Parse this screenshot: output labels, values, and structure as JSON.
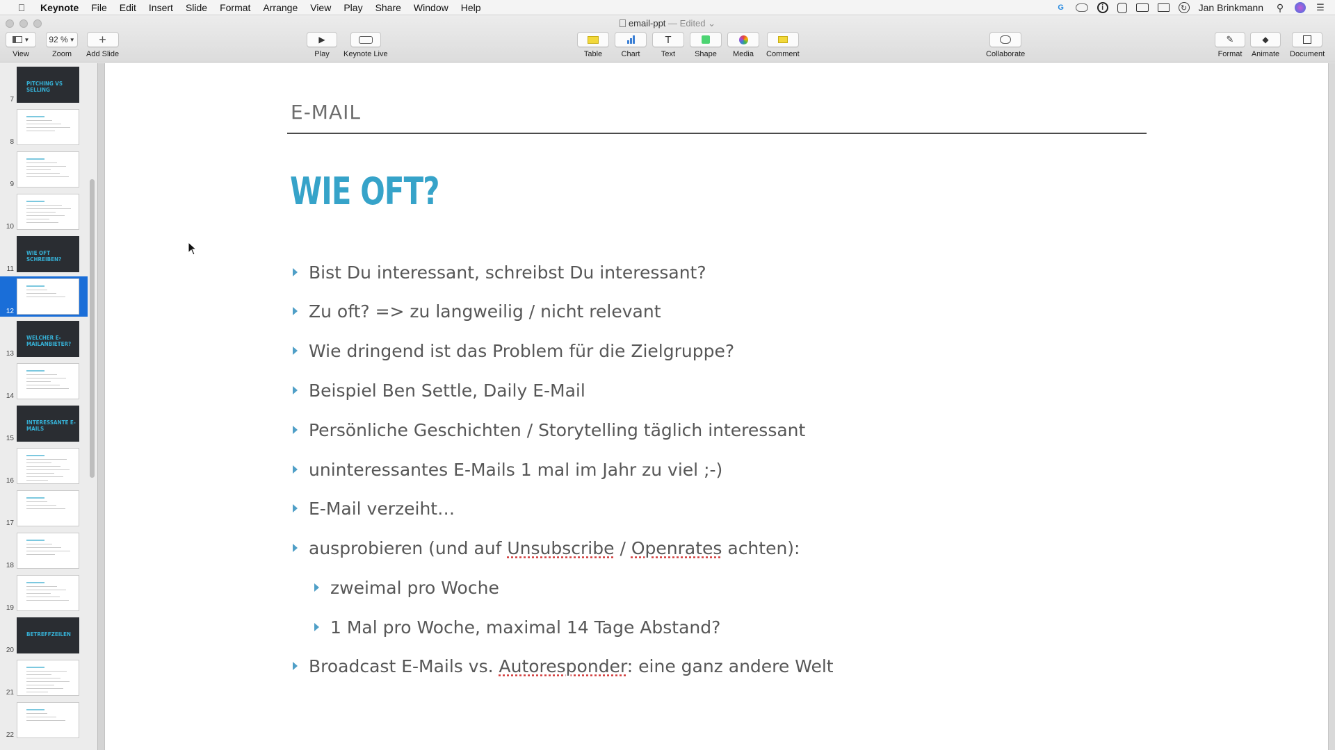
{
  "menubar": {
    "app": "Keynote",
    "items": [
      "File",
      "Edit",
      "Insert",
      "Slide",
      "Format",
      "Arrange",
      "View",
      "Play",
      "Share",
      "Window",
      "Help"
    ],
    "user": "Jan Brinkmann"
  },
  "window": {
    "doc_name": "email-ppt",
    "doc_status": "— Edited ⌄"
  },
  "toolbar": {
    "view": "View",
    "zoom_value": "92 %",
    "zoom": "Zoom",
    "add_slide": "Add Slide",
    "play": "Play",
    "keynote_live": "Keynote Live",
    "table": "Table",
    "chart": "Chart",
    "text": "Text",
    "shape": "Shape",
    "media": "Media",
    "comment": "Comment",
    "collaborate": "Collaborate",
    "format": "Format",
    "animate": "Animate",
    "document": "Document"
  },
  "navigator": {
    "slides": [
      {
        "num": "7",
        "dark": true,
        "title": "PITCHING VS SELLING"
      },
      {
        "num": "8",
        "dark": false,
        "title": ""
      },
      {
        "num": "9",
        "dark": false,
        "title": ""
      },
      {
        "num": "10",
        "dark": false,
        "title": ""
      },
      {
        "num": "11",
        "dark": true,
        "title": "WIE OFT SCHREIBEN?"
      },
      {
        "num": "12",
        "dark": false,
        "title": "",
        "selected": true
      },
      {
        "num": "13",
        "dark": true,
        "title": "WELCHER E-MAILANBIETER?"
      },
      {
        "num": "14",
        "dark": false,
        "title": ""
      },
      {
        "num": "15",
        "dark": true,
        "title": "INTERESSANTE E-MAILS"
      },
      {
        "num": "16",
        "dark": false,
        "title": ""
      },
      {
        "num": "17",
        "dark": false,
        "title": ""
      },
      {
        "num": "18",
        "dark": false,
        "title": ""
      },
      {
        "num": "19",
        "dark": false,
        "title": ""
      },
      {
        "num": "20",
        "dark": true,
        "title": "BETREFFZEILEN"
      },
      {
        "num": "21",
        "dark": false,
        "title": ""
      },
      {
        "num": "22",
        "dark": false,
        "title": ""
      }
    ]
  },
  "slide": {
    "kicker": "E-MAIL",
    "title": "WIE OFT?",
    "bullets": [
      "Bist Du interessant, schreibst Du interessant?",
      "Zu oft? => zu langweilig / nicht relevant",
      "Wie dringend ist das Problem für die Zielgruppe?",
      "Beispiel Ben Settle, Daily E-Mail",
      "Persönliche Geschichten / Storytelling täglich interessant",
      "uninteressantes E-Mails 1 mal im Jahr zu viel ;-)",
      "E-Mail verzeiht…"
    ],
    "b8": {
      "a": "ausprobieren (und auf ",
      "b": "Unsubscribe",
      "c": " / ",
      "d": "Openrates",
      "e": " achten):"
    },
    "sub1": "zweimal pro Woche",
    "sub2": "1 Mal pro Woche, maximal 14 Tage Abstand?",
    "b9": {
      "a": "Broadcast E-Mails vs. ",
      "b": "Autoresponder",
      "c": ": eine ganz andere Welt"
    }
  }
}
